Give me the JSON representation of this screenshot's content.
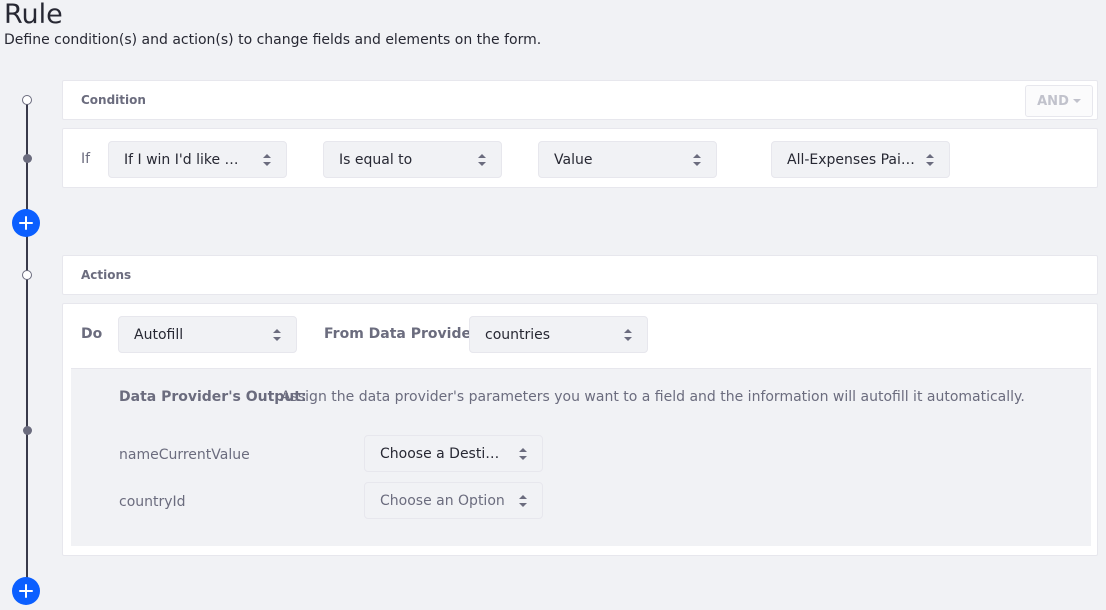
{
  "header": {
    "title": "Rule",
    "description": "Define condition(s) and action(s) to change fields and elements on the form."
  },
  "condition": {
    "label": "Condition",
    "operator_button": "AND",
    "row": {
      "if_label": "If",
      "field": "If I win I'd like my a...",
      "comparator": "Is equal to",
      "type": "Value",
      "value": "All-Expenses Paid ..."
    }
  },
  "actions": {
    "label": "Actions",
    "row": {
      "do_label": "Do",
      "action": "Autofill",
      "provider_label": "From Data Provider",
      "provider": "countries"
    },
    "output": {
      "title": "Data Provider's Output:",
      "description": "Assign the data provider's parameters you want to a field and the information will autofill it automatically.",
      "params": [
        {
          "name": "nameCurrentValue",
          "value": "Choose a Destinati...",
          "placeholder": false
        },
        {
          "name": "countryId",
          "value": "Choose an Option",
          "placeholder": true
        }
      ]
    }
  },
  "icons": {
    "add_condition": "plus-icon",
    "add_action": "plus-icon",
    "select_caret": "caret-double-icon"
  },
  "colors": {
    "accent": "#0b5fff",
    "background": "#f1f2f5",
    "timeline": "#393a4a"
  }
}
